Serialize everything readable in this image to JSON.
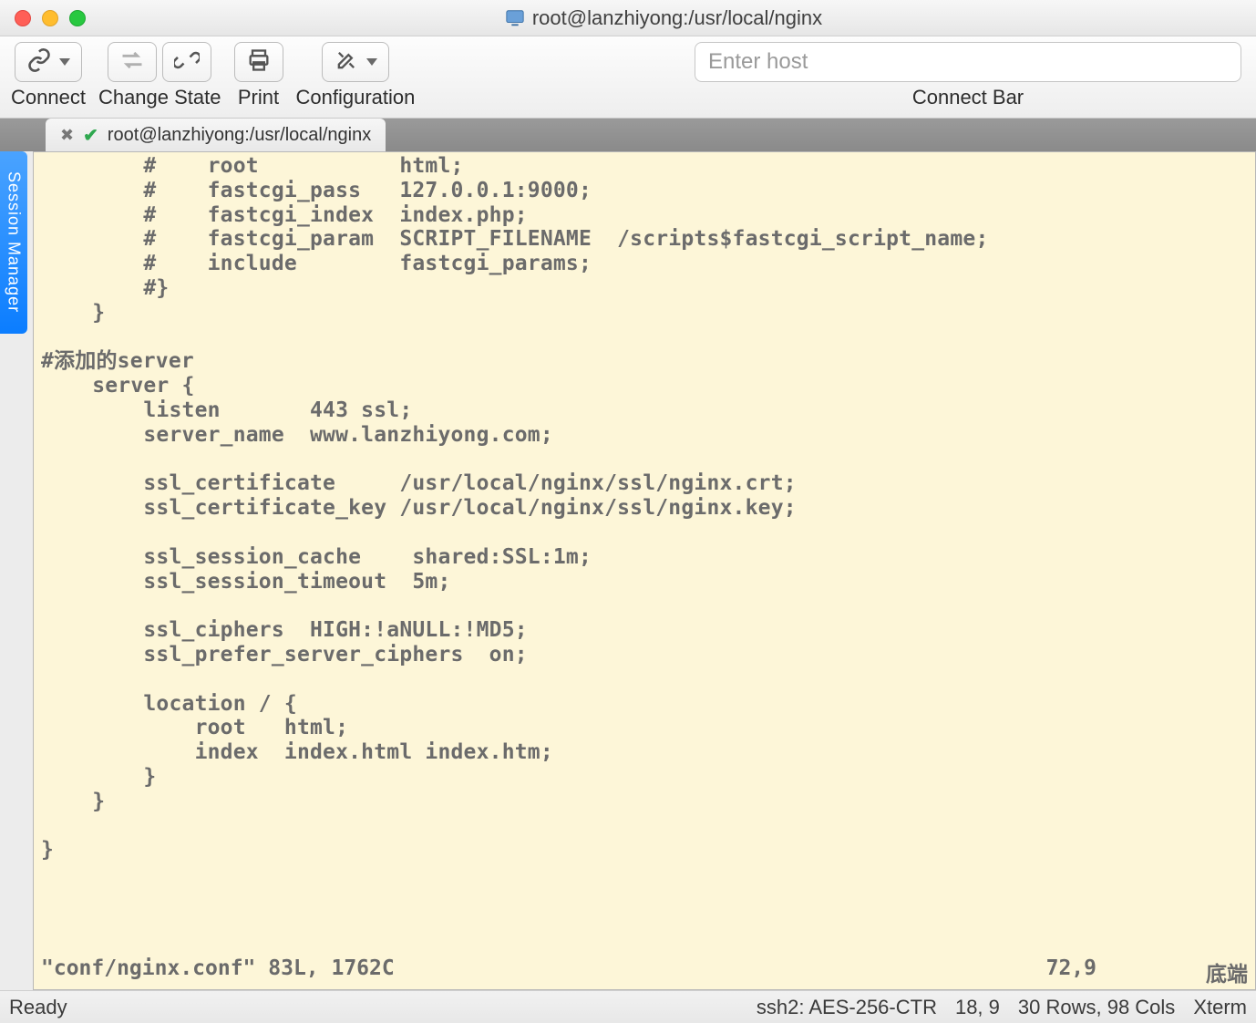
{
  "window": {
    "title": "root@lanzhiyong:/usr/local/nginx"
  },
  "toolbar": {
    "connect": {
      "label": "Connect"
    },
    "change_state": {
      "label": "Change State"
    },
    "print": {
      "label": "Print"
    },
    "configuration": {
      "label": "Configuration"
    },
    "host_input": {
      "placeholder": "Enter host",
      "value": ""
    },
    "connect_bar": {
      "label": "Connect Bar"
    }
  },
  "session_manager": {
    "label": "Session Manager"
  },
  "tabs": [
    {
      "title": "root@lanzhiyong:/usr/local/nginx"
    }
  ],
  "terminal": {
    "lines": [
      "        #    root           html;",
      "        #    fastcgi_pass   127.0.0.1:9000;",
      "        #    fastcgi_index  index.php;",
      "        #    fastcgi_param  SCRIPT_FILENAME  /scripts$fastcgi_script_name;",
      "        #    include        fastcgi_params;",
      "        #}",
      "    }",
      "",
      "#添加的server",
      "    server {",
      "        listen       443 ssl;",
      "        server_name  www.lanzhiyong.com;",
      "",
      "        ssl_certificate     /usr/local/nginx/ssl/nginx.crt;",
      "        ssl_certificate_key /usr/local/nginx/ssl/nginx.key;",
      "",
      "        ssl_session_cache    shared:SSL:1m;",
      "        ssl_session_timeout  5m;",
      "",
      "        ssl_ciphers  HIGH:!aNULL:!MD5;",
      "        ssl_prefer_server_ciphers  on;",
      "",
      "        location / {",
      "            root   html;",
      "            index  index.html index.htm;",
      "        }",
      "    }",
      "",
      "}"
    ],
    "vim_status": {
      "file_info": "\"conf/nginx.conf\" 83L, 1762C",
      "cursor": "72,9",
      "position": "底端"
    }
  },
  "statusbar": {
    "ready": "Ready",
    "cipher": "ssh2: AES-256-CTR",
    "cursor": "18, 9",
    "dims": "30 Rows, 98 Cols",
    "term": "Xterm"
  }
}
